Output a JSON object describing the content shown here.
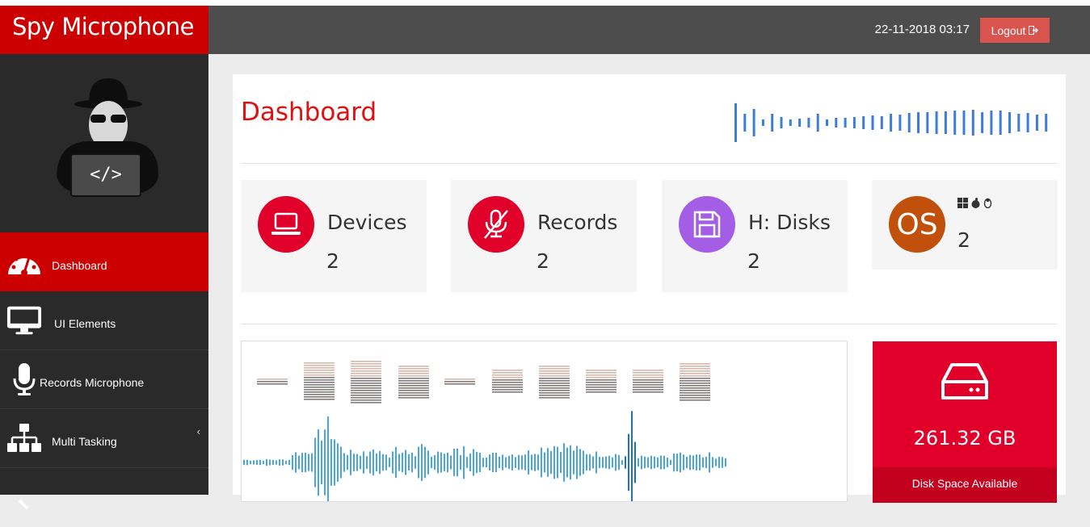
{
  "app": {
    "brand": "Spy Microphone"
  },
  "header": {
    "datetime": "22-11-2018 03:17",
    "logout_label": "Logout"
  },
  "sidebar": {
    "items": [
      {
        "label": "Dashboard",
        "icon": "dashboard-gauge-icon",
        "active": true
      },
      {
        "label": "UI Elements",
        "icon": "desktop-icon"
      },
      {
        "label": "Records Microphone",
        "icon": "microphone-icon"
      },
      {
        "label": "Multi Tasking",
        "icon": "sitemap-icon"
      }
    ]
  },
  "main": {
    "title": "Dashboard",
    "cards": [
      {
        "label": "Devices",
        "value": "2",
        "color": "#e0002a",
        "icon": "laptop-icon"
      },
      {
        "label": "Records",
        "value": "2",
        "color": "#e0002a",
        "icon": "microphone-slash-icon"
      },
      {
        "label": "H: Disks",
        "value": "2",
        "color": "#a45ee5",
        "icon": "floppy-disk-icon"
      },
      {
        "label": "OS",
        "value": "2",
        "color": "#c0500a",
        "icon": "os-icons"
      }
    ],
    "disk": {
      "size": "261.32 GB",
      "caption": "Disk Space Available"
    }
  },
  "colors": {
    "brand_red": "#cc0000",
    "topbar": "#4d4d4d",
    "sidebar": "#2a2a2a",
    "wave_blue": "#3b7dd8"
  }
}
